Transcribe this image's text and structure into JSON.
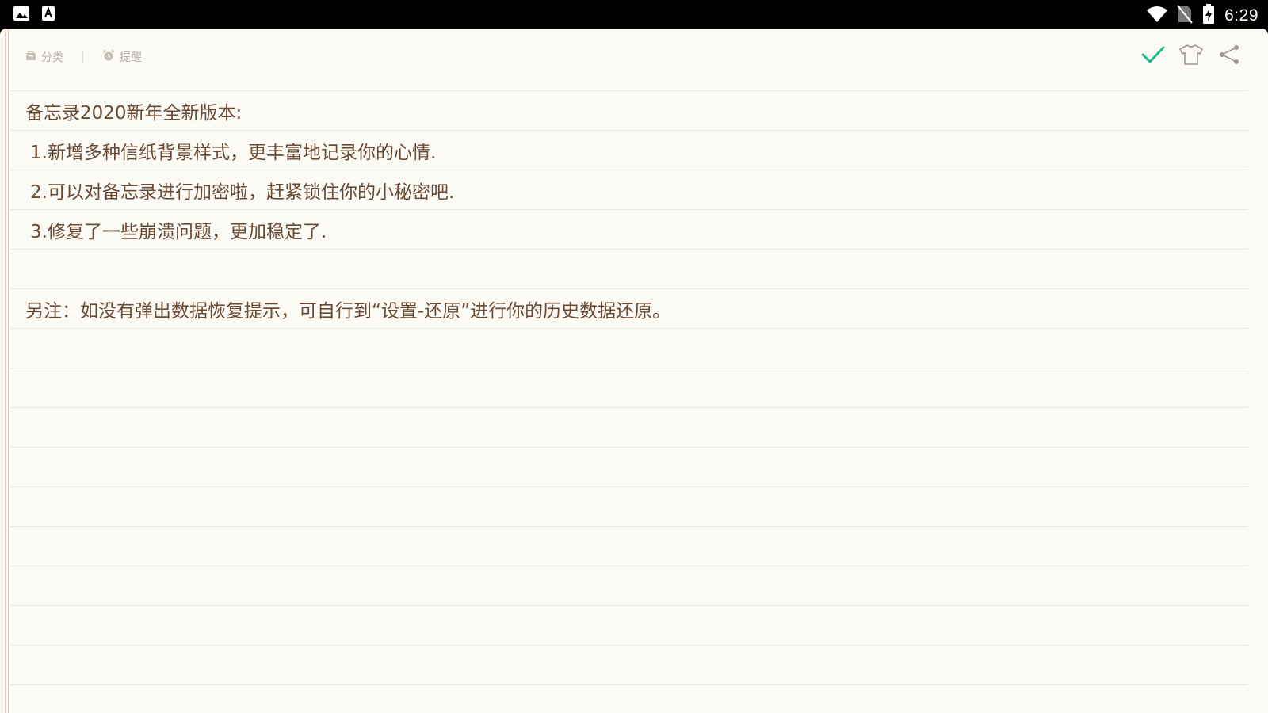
{
  "status_bar": {
    "left_icons": [
      "image-icon",
      "text-a-icon"
    ],
    "right_icons": [
      "wifi-icon",
      "no-sim-icon",
      "battery-charging-icon"
    ],
    "time": "6:29"
  },
  "toolbar": {
    "category_label": "分类",
    "reminder_label": "提醒",
    "actions": [
      "check-icon",
      "tshirt-icon",
      "share-icon"
    ],
    "accent_color": "#1fba8a"
  },
  "note": {
    "lines": [
      "备忘录2020新年全新版本:",
      "1.新增多种信纸背景样式，更丰富地记录你的心情.",
      "2.可以对备忘录进行加密啦，赶紧锁住你的小秘密吧.",
      "3.修复了一些崩溃问题，更加稳定了.",
      "",
      "另注：如没有弹出数据恢复提示，可自行到“设置-还原”进行你的历史数据还原。",
      "",
      "",
      "",
      "",
      "",
      "",
      "",
      "",
      "",
      ""
    ],
    "text_color": "#6b4a34",
    "paper_color": "#fcfaf5"
  }
}
